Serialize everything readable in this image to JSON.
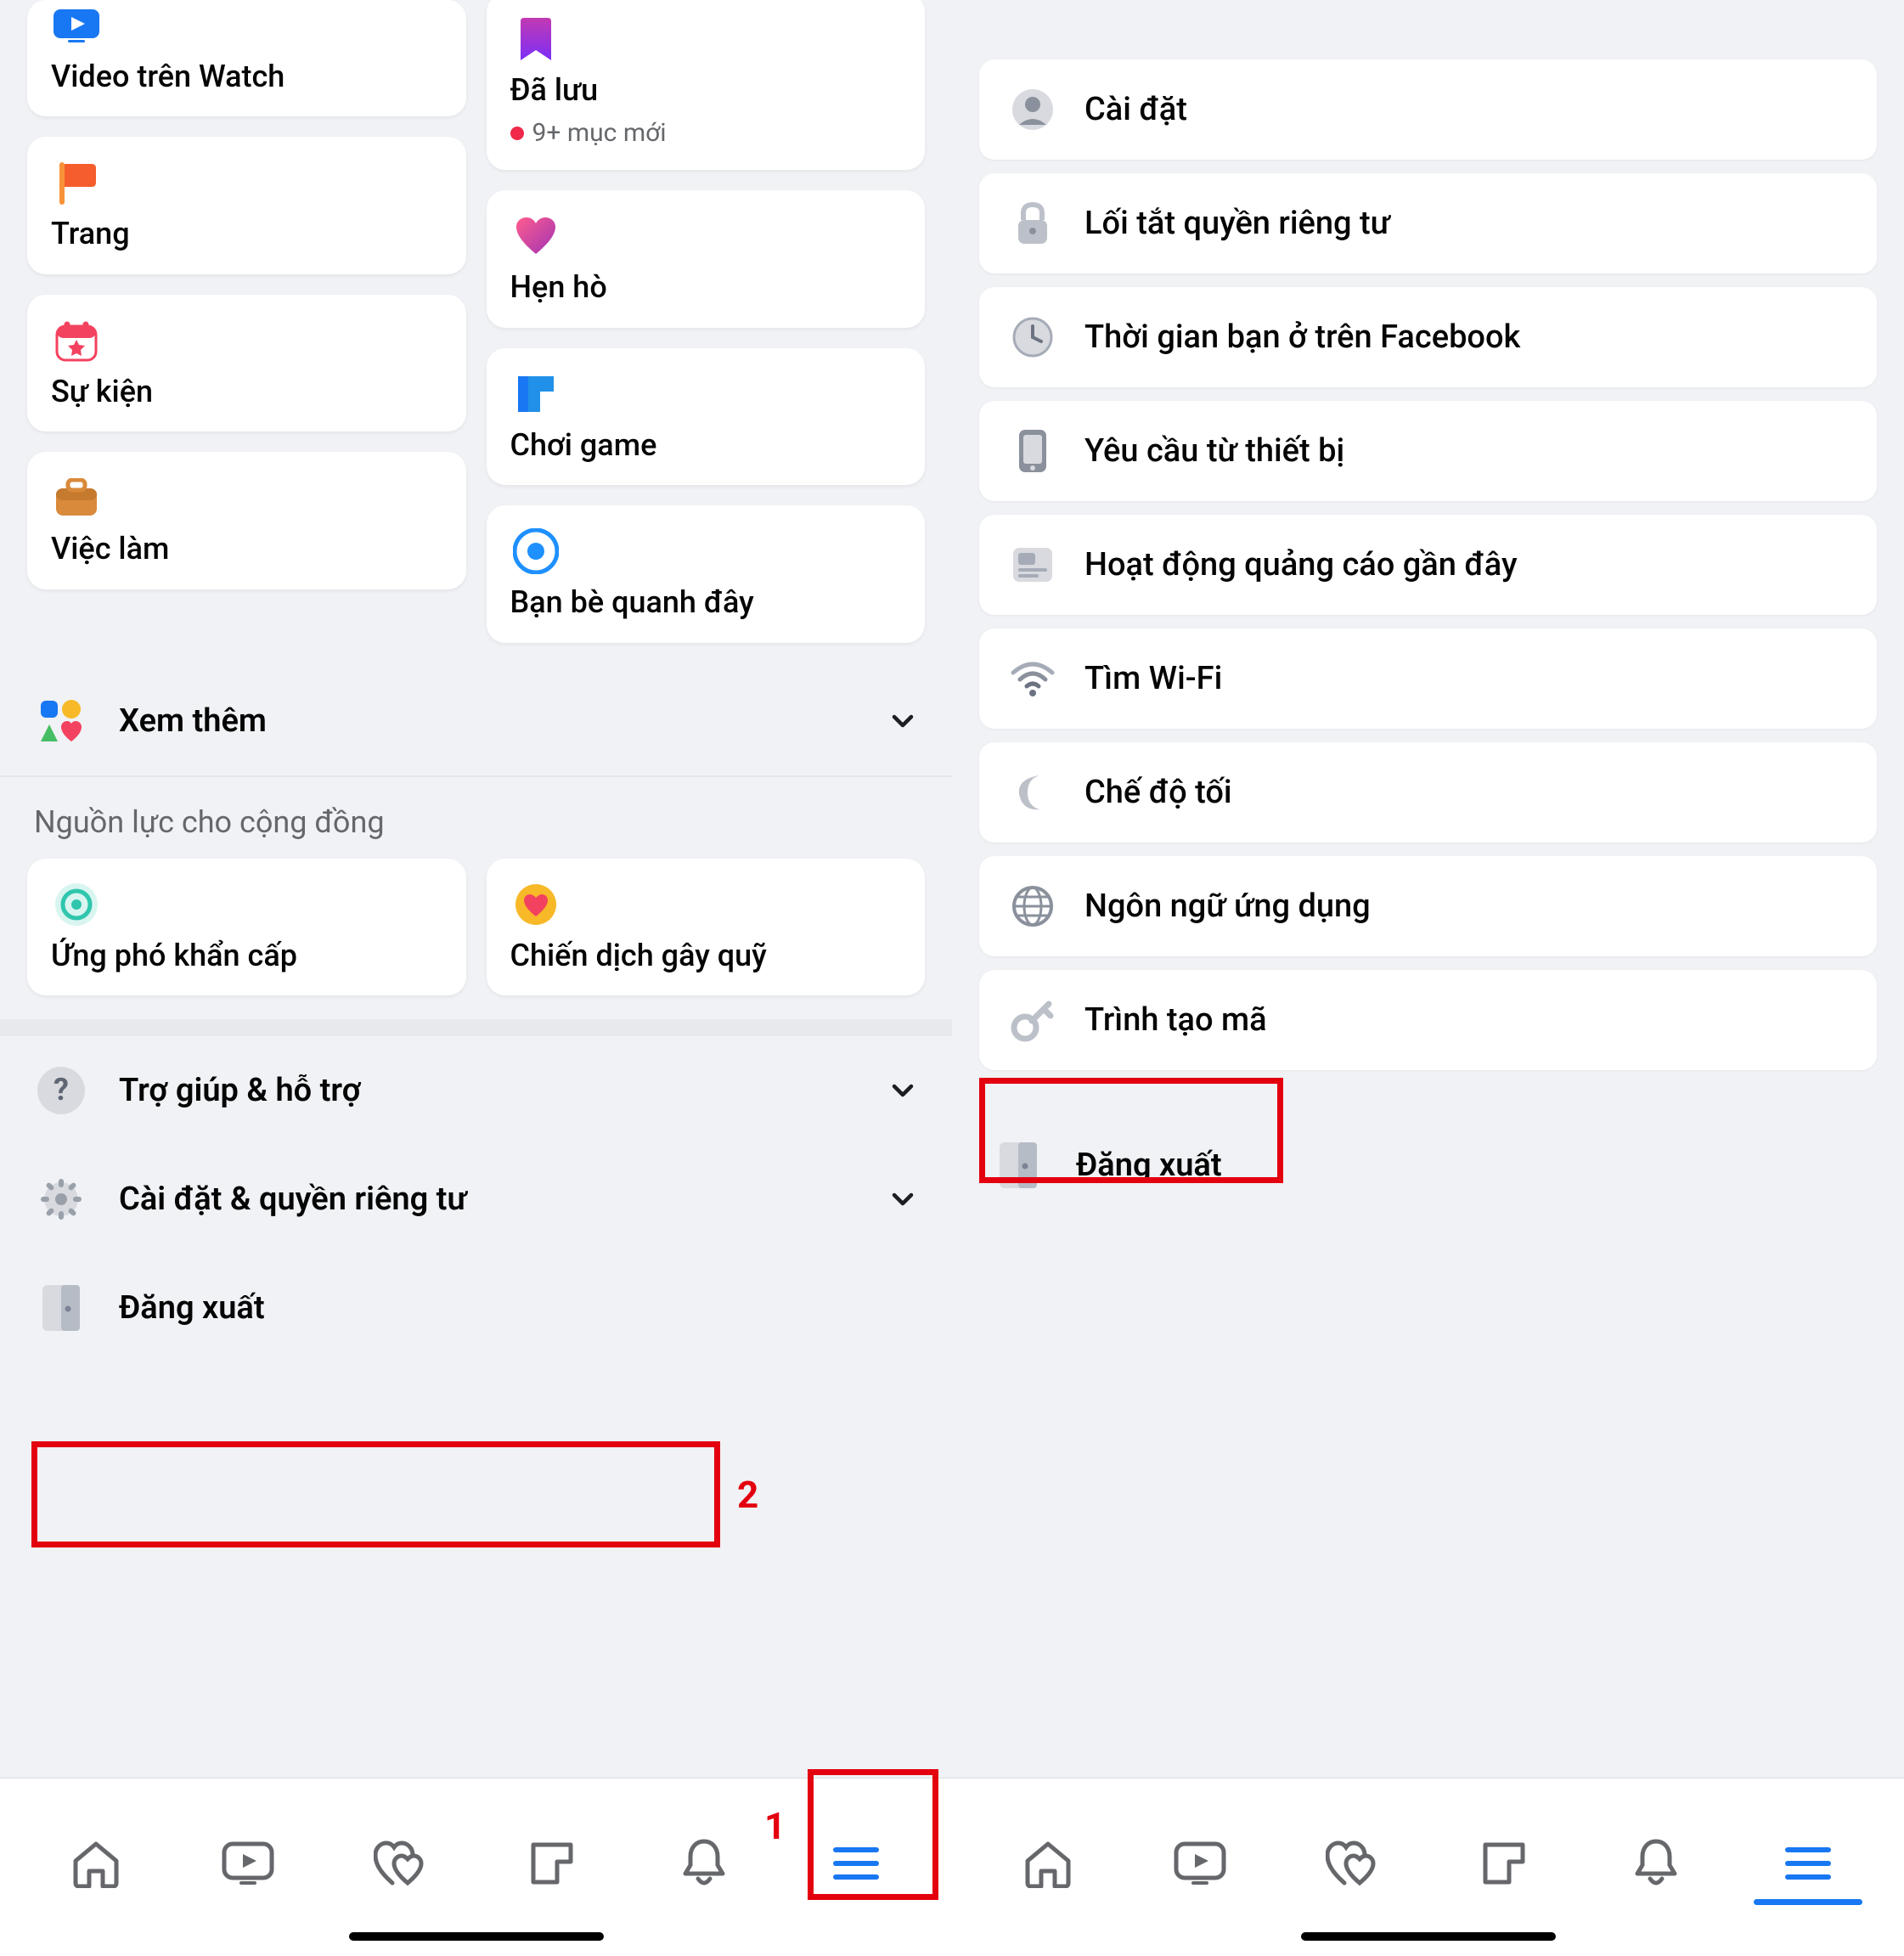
{
  "left": {
    "cards_col1": [
      {
        "label": "Video trên Watch"
      },
      {
        "label": "Trang"
      },
      {
        "label": "Sự kiện"
      },
      {
        "label": "Việc làm"
      }
    ],
    "cards_col2": [
      {
        "label": "Đã lưu",
        "sub": "9+ mục mới"
      },
      {
        "label": "Hẹn hò"
      },
      {
        "label": "Chơi game"
      },
      {
        "label": "Bạn bè quanh đây"
      }
    ],
    "see_more": "Xem thêm",
    "community_header": "Nguồn lực cho cộng đồng",
    "community_cards": [
      {
        "label": "Ứng phó khẩn cấp"
      },
      {
        "label": "Chiến dịch gây quỹ"
      }
    ],
    "help_row": "Trợ giúp & hỗ trợ",
    "settings_row": "Cài đặt & quyền riêng tư",
    "logout_row": "Đăng xuất",
    "annot1": "1",
    "annot2": "2"
  },
  "right": {
    "rows": [
      {
        "label": "Cài đặt"
      },
      {
        "label": "Lối tắt quyền riêng tư"
      },
      {
        "label": "Thời gian bạn ở trên Facebook"
      },
      {
        "label": "Yêu cầu từ thiết bị"
      },
      {
        "label": "Hoạt động quảng cáo gần đây"
      },
      {
        "label": "Tìm Wi-Fi"
      },
      {
        "label": "Chế độ tối"
      },
      {
        "label": "Ngôn ngữ ứng dụng"
      },
      {
        "label": "Trình tạo mã"
      }
    ],
    "logout_row": "Đăng xuất"
  }
}
